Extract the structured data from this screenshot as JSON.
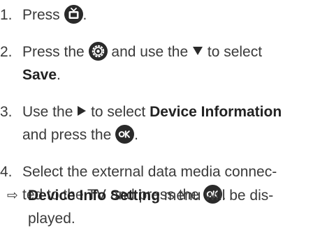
{
  "steps": [
    {
      "number": "1.",
      "press": "Press",
      "period": "."
    },
    {
      "number": "2.",
      "press_the": "Press the",
      "and_use_the": "and use the",
      "to_select": "to select",
      "item": "Save",
      "period": "."
    },
    {
      "number": "3.",
      "use_the": "Use the",
      "to_select": "to select",
      "item": "Device Information",
      "and_press_the": "and press the",
      "period": "."
    },
    {
      "number": "4.",
      "line1": "Select the external data media connec-",
      "line2": "ted to the TV and press the",
      "period": "."
    }
  ],
  "result": {
    "arrow": "⇨",
    "item": "Device Info Setting",
    "rest_line1": "menu will be dis-",
    "line2": "played."
  },
  "icons": {
    "tv": "tv-icon",
    "settings": "settings-gear-icon",
    "down": "down-triangle-icon",
    "right": "right-triangle-icon",
    "ok": "ok-button-icon"
  },
  "colors": {
    "text": "#3a3a3a",
    "icon": "#2a2a2a"
  }
}
